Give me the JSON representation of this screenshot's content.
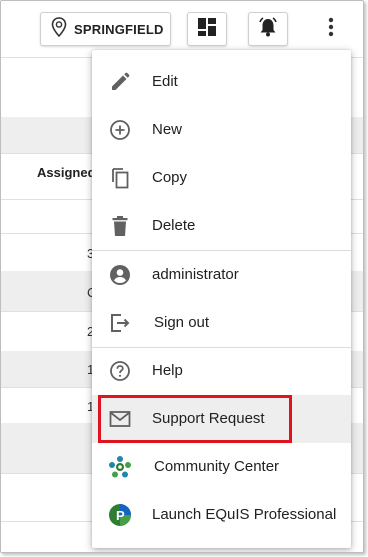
{
  "header": {
    "location_label": "SPRINGFIELD",
    "location_icon": "location-pin-icon",
    "dashboard_icon": "dashboard-icon",
    "alerts_icon": "bell-icon",
    "more_icon": "more-vert-icon"
  },
  "background_table": {
    "column_header": "Assigned",
    "cells": [
      "3",
      "C",
      "2",
      "1",
      "1"
    ]
  },
  "menu": {
    "items": [
      {
        "label": "Edit",
        "icon": "pencil-icon"
      },
      {
        "label": "New",
        "icon": "add-circle-icon"
      },
      {
        "label": "Copy",
        "icon": "copy-icon"
      },
      {
        "label": "Delete",
        "icon": "trash-icon"
      },
      {
        "label": "administrator",
        "icon": "account-circle-icon"
      },
      {
        "label": "Sign out",
        "icon": "sign-out-icon"
      },
      {
        "label": "Help",
        "icon": "help-circle-icon"
      },
      {
        "label": "Support Request",
        "icon": "mail-icon"
      },
      {
        "label": "Community Center",
        "icon": "community-icon"
      },
      {
        "label": "Launch EQuIS Professional",
        "icon": "equis-pro-icon"
      }
    ]
  },
  "colors": {
    "highlight": "#e0141e",
    "icon_grey": "#616161",
    "selected_bg": "#eeeeee"
  }
}
